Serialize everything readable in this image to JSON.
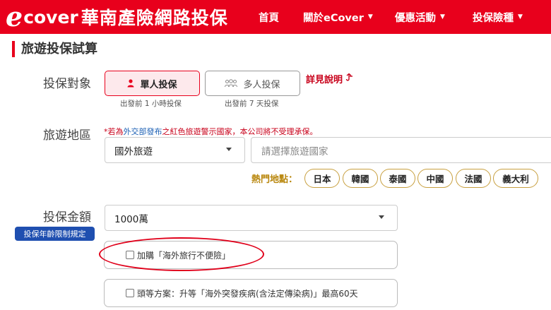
{
  "header": {
    "logo_e": "e",
    "logo_cover": "cover",
    "logo_cn": "華南產險網路投保",
    "nav": [
      {
        "label": "首頁",
        "has_caret": false
      },
      {
        "label": "關於eCover",
        "has_caret": true
      },
      {
        "label": "優惠活動",
        "has_caret": true
      },
      {
        "label": "投保險種",
        "has_caret": true
      }
    ],
    "caret": "▼"
  },
  "page_title": "旅遊投保試算",
  "insured": {
    "label": "投保對象",
    "single": {
      "label": "單人投保",
      "note": "出發前 1 小時投保"
    },
    "multi": {
      "label": "多人投保",
      "note": "出發前 7 天投保"
    },
    "detail_link": "詳見說明",
    "detail_icon": "curved-arrow-icon"
  },
  "region": {
    "label": "旅遊地區",
    "warning_prefix": "*若為",
    "warning_link": "外交部發布",
    "warning_suffix": "之紅色旅遊警示國家，本公司將不受理承保。",
    "type_value": "國外旅遊",
    "country_placeholder": "請選擇旅遊國家",
    "hot_label": "熱門地點：",
    "hot_spots": [
      "日本",
      "韓國",
      "泰國",
      "中國",
      "法國",
      "義大利"
    ]
  },
  "amount": {
    "label": "投保金額",
    "age_badge": "投保年齡限制規定",
    "value": "1000萬"
  },
  "addons": [
    {
      "label": "加購「海外旅行不便險」",
      "checked": false
    },
    {
      "label": "頭等方案：升等「海外突發疾病(含法定傳染病)」最高60天",
      "checked": false
    }
  ],
  "colors": {
    "brand_red": "#e8001c",
    "badge_blue": "#1f4fb0",
    "chip_gold": "#c8a040"
  }
}
